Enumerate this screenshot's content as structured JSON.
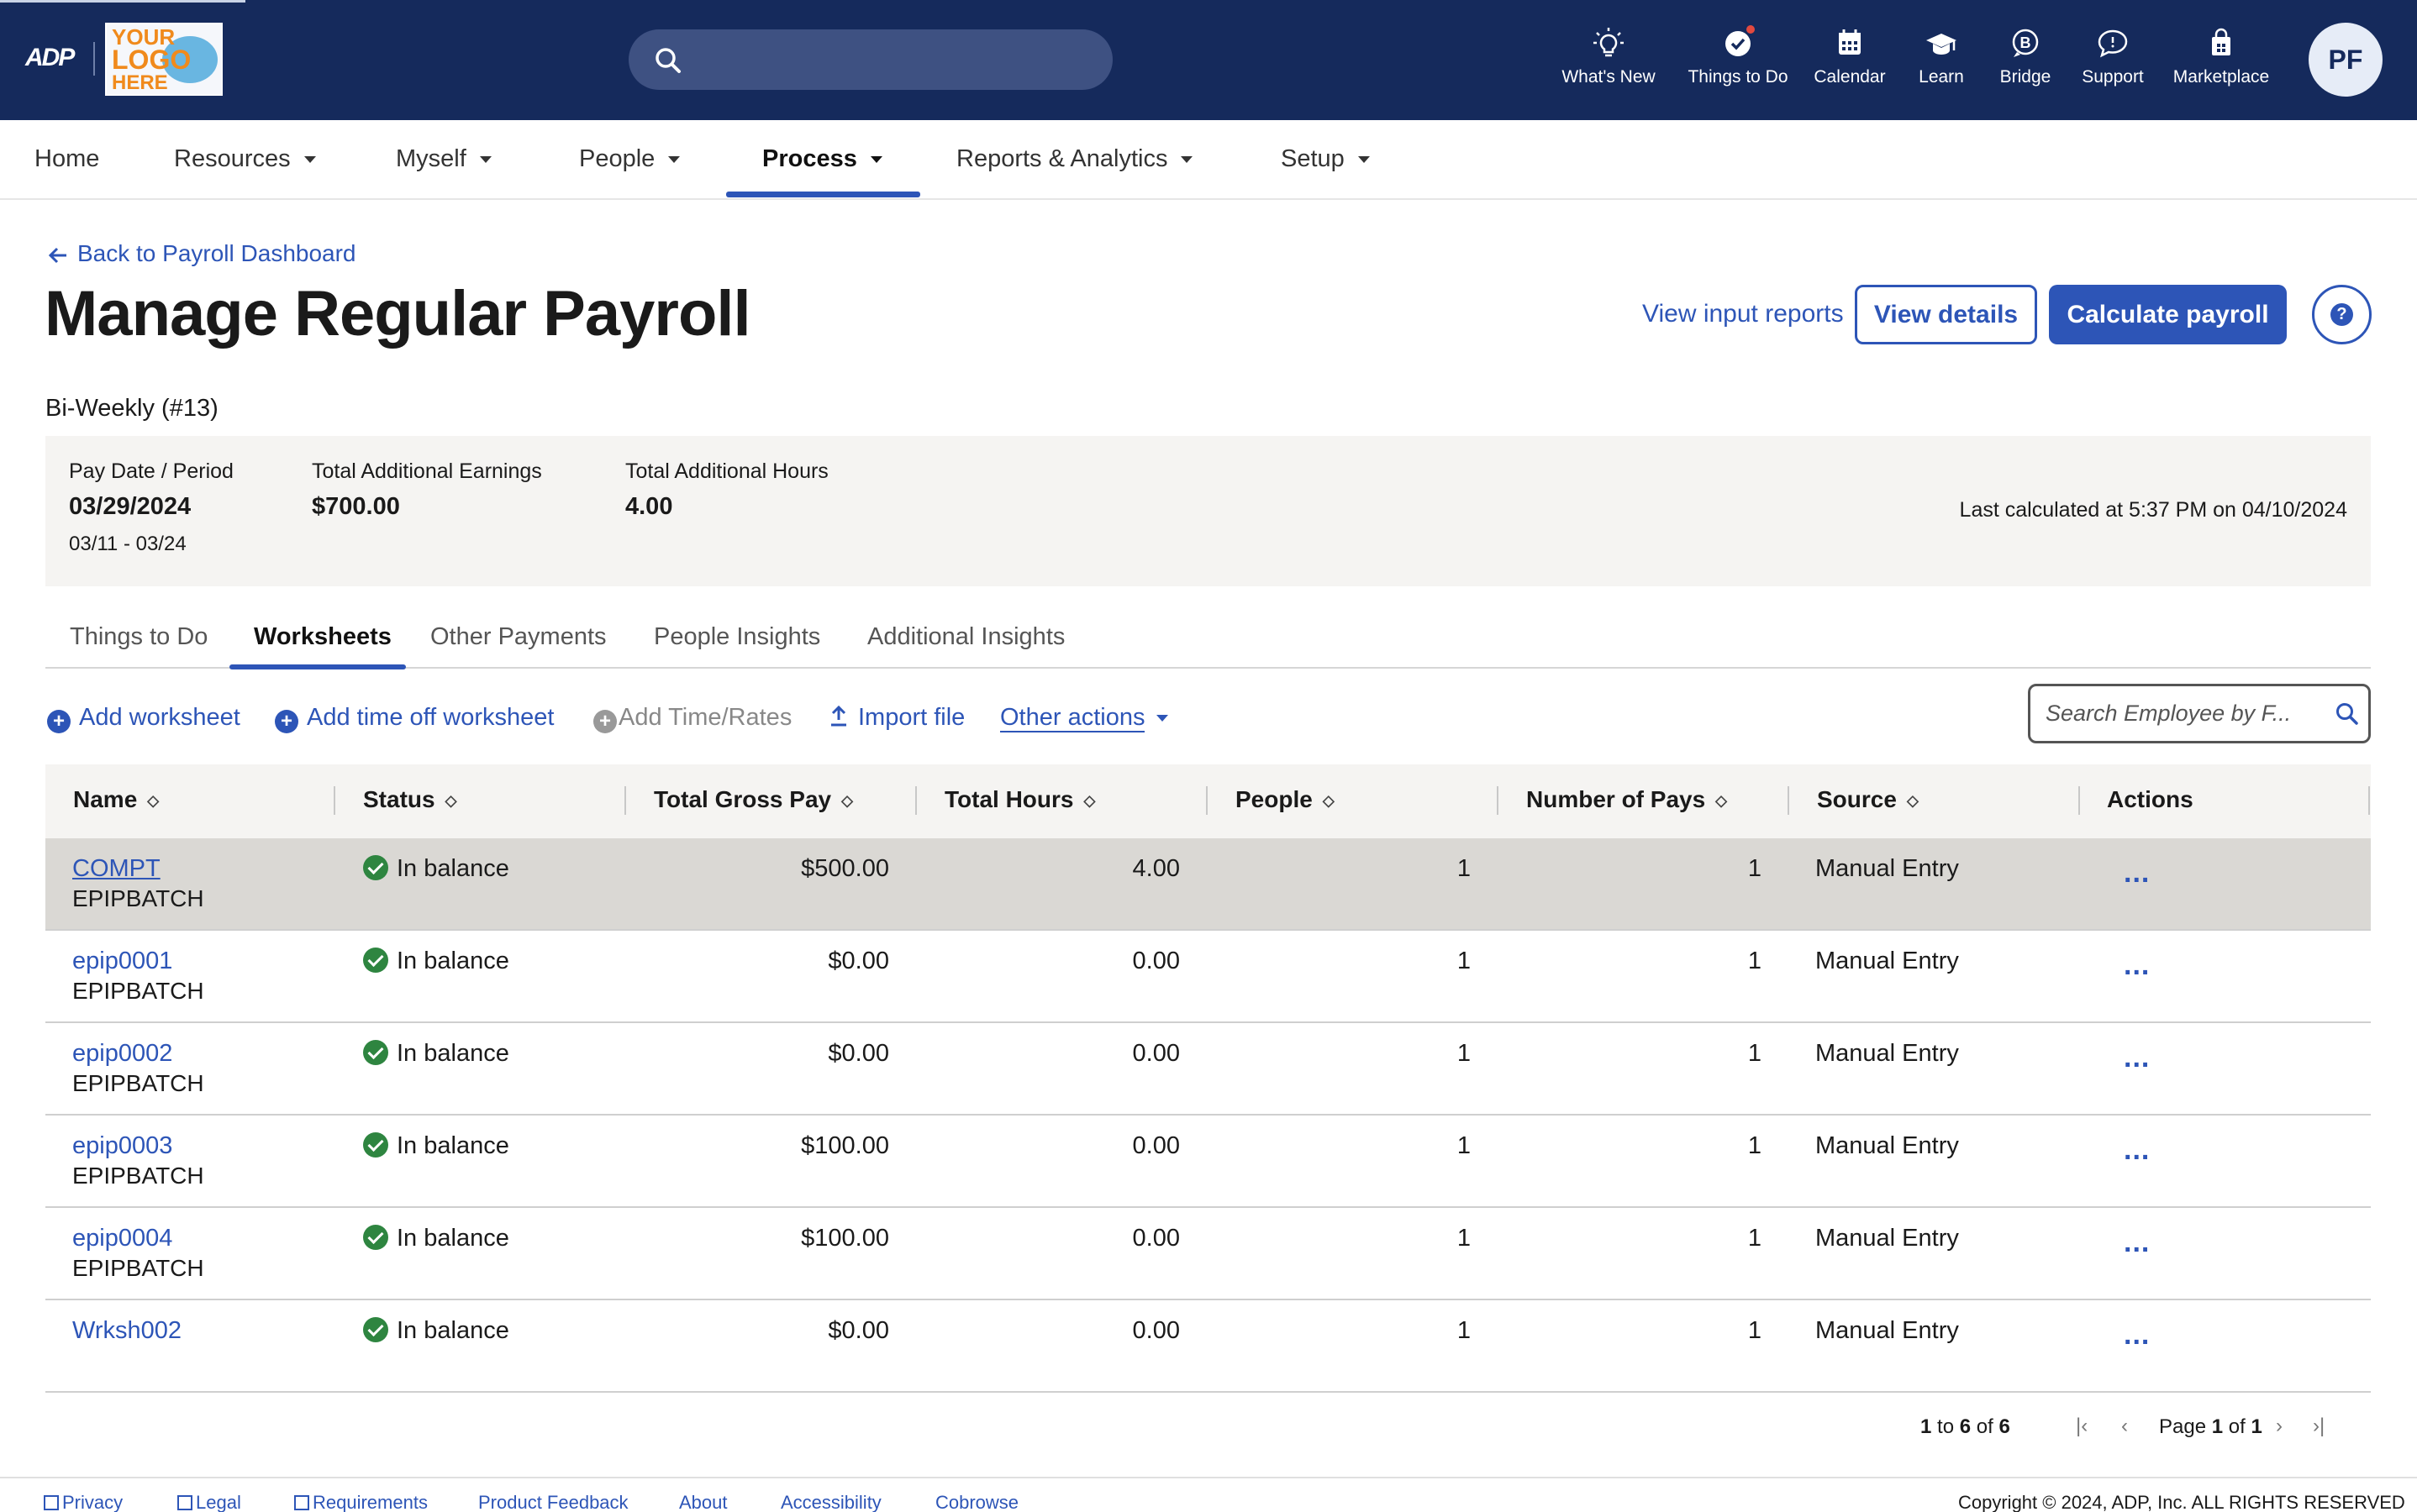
{
  "header": {
    "brand": "ADP",
    "logo_placeholder": {
      "line1": "YOUR",
      "line2": "LOGO",
      "line3": "HERE"
    },
    "search_placeholder": "",
    "icons": [
      {
        "name": "lightbulb-icon",
        "label": "What's New"
      },
      {
        "name": "checkmark-icon",
        "label": "Things to Do",
        "has_notification": true
      },
      {
        "name": "calendar-icon",
        "label": "Calendar"
      },
      {
        "name": "graduation-cap-icon",
        "label": "Learn"
      },
      {
        "name": "bridge-icon",
        "label": "Bridge"
      },
      {
        "name": "chat-bubble-icon",
        "label": "Support"
      },
      {
        "name": "shopping-bag-icon",
        "label": "Marketplace"
      }
    ],
    "user_initials": "PF"
  },
  "nav": {
    "items": [
      {
        "label": "Home",
        "dropdown": false
      },
      {
        "label": "Resources",
        "dropdown": true
      },
      {
        "label": "Myself",
        "dropdown": true
      },
      {
        "label": "People",
        "dropdown": true
      },
      {
        "label": "Process",
        "dropdown": true,
        "active": true
      },
      {
        "label": "Reports & Analytics",
        "dropdown": true
      },
      {
        "label": "Setup",
        "dropdown": true
      }
    ]
  },
  "page": {
    "back_link": "Back to Payroll Dashboard",
    "title": "Manage Regular Payroll",
    "view_input_reports": "View input reports",
    "view_details": "View details",
    "calculate_payroll": "Calculate payroll",
    "help": "?",
    "frequency": "Bi-Weekly (#13)"
  },
  "summary": {
    "pay_date_label": "Pay Date / Period",
    "pay_date": "03/29/2024",
    "period": "03/11 - 03/24",
    "earnings_label": "Total Additional Earnings",
    "earnings": "$700.00",
    "hours_label": "Total Additional Hours",
    "hours": "4.00",
    "last_calculated": "Last calculated at 5:37 PM on 04/10/2024"
  },
  "tabs": [
    "Things to Do",
    "Worksheets",
    "Other Payments",
    "People Insights",
    "Additional Insights"
  ],
  "active_tab": "Worksheets",
  "actions": {
    "add_worksheet": "Add worksheet",
    "add_time_off": "Add time off worksheet",
    "add_time_rates": "Add Time/Rates",
    "import_file": "Import file",
    "other_actions": "Other actions",
    "search_placeholder": "Search Employee by F..."
  },
  "table": {
    "columns": [
      "Name",
      "Status",
      "Total Gross Pay",
      "Total Hours",
      "People",
      "Number of Pays",
      "Source",
      "Actions"
    ],
    "rows": [
      {
        "name": "COMPT",
        "batch": "EPIPBATCH",
        "status": "In balance",
        "gross": "$500.00",
        "hours": "4.00",
        "people": "1",
        "pays": "1",
        "source": "Manual Entry",
        "actions": "..."
      },
      {
        "name": "epip0001",
        "batch": "EPIPBATCH",
        "status": "In balance",
        "gross": "$0.00",
        "hours": "0.00",
        "people": "1",
        "pays": "1",
        "source": "Manual Entry",
        "actions": "..."
      },
      {
        "name": "epip0002",
        "batch": "EPIPBATCH",
        "status": "In balance",
        "gross": "$0.00",
        "hours": "0.00",
        "people": "1",
        "pays": "1",
        "source": "Manual Entry",
        "actions": "..."
      },
      {
        "name": "epip0003",
        "batch": "EPIPBATCH",
        "status": "In balance",
        "gross": "$100.00",
        "hours": "0.00",
        "people": "1",
        "pays": "1",
        "source": "Manual Entry",
        "actions": "..."
      },
      {
        "name": "epip0004",
        "batch": "EPIPBATCH",
        "status": "In balance",
        "gross": "$100.00",
        "hours": "0.00",
        "people": "1",
        "pays": "1",
        "source": "Manual Entry",
        "actions": "..."
      },
      {
        "name": "Wrksh002",
        "batch": "",
        "status": "In balance",
        "gross": "$0.00",
        "hours": "0.00",
        "people": "1",
        "pays": "1",
        "source": "Manual Entry",
        "actions": "..."
      }
    ]
  },
  "pagination": {
    "range_start": "1",
    "range_to": "to",
    "range_end": "6",
    "of": "of",
    "total": "6",
    "page_label": "Page",
    "page": "1",
    "page_of": "of",
    "page_total": "1"
  },
  "footer": {
    "links": [
      "Privacy",
      "Legal",
      "Requirements",
      "Product Feedback",
      "About",
      "Accessibility",
      "Cobrowse"
    ],
    "copyright": "Copyright © 2024, ADP, Inc. ALL RIGHTS RESERVED"
  },
  "colors": {
    "header_bg": "#152a5c",
    "accent": "#2d55b7",
    "status_ok": "#2e8540",
    "notification": "#e2493f"
  }
}
